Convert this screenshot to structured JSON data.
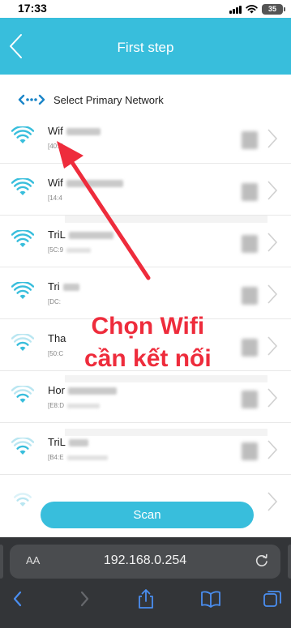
{
  "status_bar": {
    "time": "17:33",
    "battery": "35"
  },
  "header": {
    "title": "First step",
    "back_icon": "chevron-left-icon"
  },
  "section": {
    "icon": "network-link-icon",
    "title": "Select Primary Network"
  },
  "networks": [
    {
      "name_prefix": "Wif",
      "mac_prefix": "[40:E"
    },
    {
      "name_prefix": "Wif",
      "mac_prefix": "[14:4"
    },
    {
      "name_prefix": "TriL",
      "mac_prefix": "[5C:9"
    },
    {
      "name_prefix": "Tri",
      "mac_prefix": "[DC:"
    },
    {
      "name_prefix": "Tha",
      "mac_prefix": "[50:C"
    },
    {
      "name_prefix": "Hor",
      "mac_prefix": "[E8:D"
    },
    {
      "name_prefix": "TriL",
      "mac_prefix": "[B4:E"
    }
  ],
  "scan_button": {
    "label": "Scan"
  },
  "annotation": {
    "line1": "Chọn Wifi",
    "line2": "cần kết nối",
    "color": "#ee2c3c"
  },
  "browser": {
    "aa_label": "AA",
    "url": "192.168.0.254"
  },
  "colors": {
    "accent": "#38bedc",
    "browser_bg": "#333538"
  }
}
